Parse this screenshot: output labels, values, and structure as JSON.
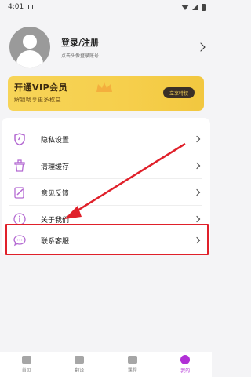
{
  "status_bar": {
    "time": "4:01"
  },
  "profile": {
    "login_label": "登录/注册",
    "hint": "点击头像登录账号"
  },
  "vip": {
    "title": "开通VIP会员",
    "subtitle": "解锁畅享更多权益",
    "button": "立享特权"
  },
  "menu": [
    {
      "label": "隐私设置",
      "icon": "shield-icon"
    },
    {
      "label": "清理缓存",
      "icon": "trash-icon"
    },
    {
      "label": "意见反馈",
      "icon": "edit-icon"
    },
    {
      "label": "关于我们",
      "icon": "info-icon"
    },
    {
      "label": "联系客服",
      "icon": "chat-icon"
    }
  ],
  "nav": [
    {
      "label": "首页",
      "icon": "home-icon"
    },
    {
      "label": "翻译",
      "icon": "translate-icon"
    },
    {
      "label": "课程",
      "icon": "course-icon"
    },
    {
      "label": "我的",
      "icon": "profile-icon",
      "active": true
    }
  ],
  "colors": {
    "accent": "#b12fd6",
    "vip_gold": "#f6cf4c",
    "annotation_red": "#e0202a",
    "icon_purple": "#b46ad2"
  }
}
